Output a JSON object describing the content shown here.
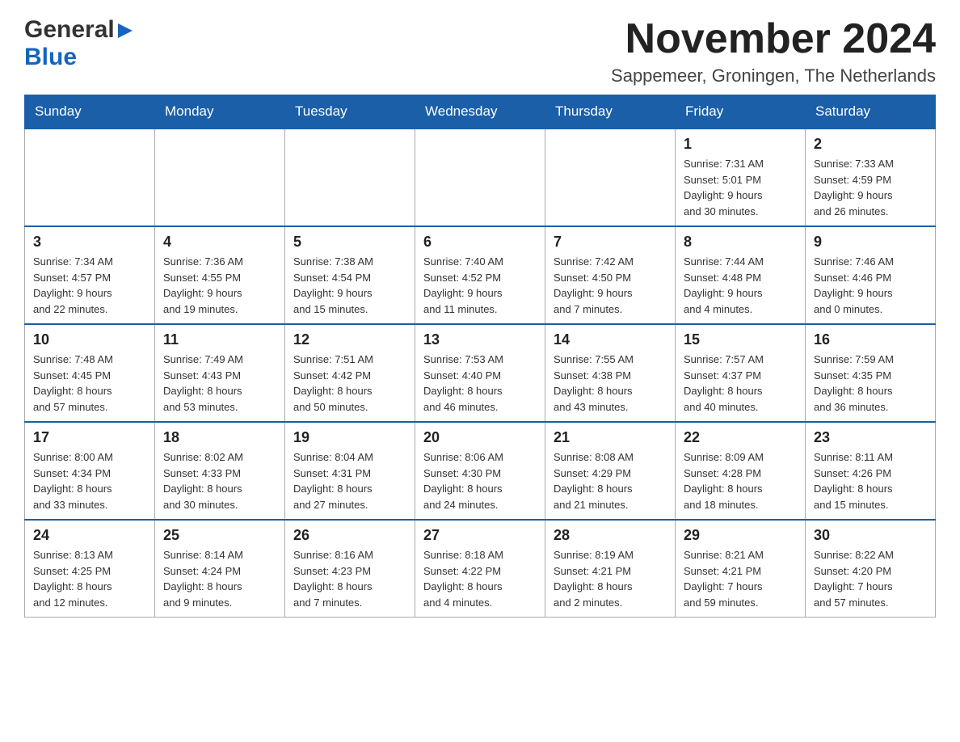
{
  "header": {
    "logo_general": "General",
    "logo_blue": "Blue",
    "month_title": "November 2024",
    "location": "Sappemeer, Groningen, The Netherlands"
  },
  "weekdays": [
    "Sunday",
    "Monday",
    "Tuesday",
    "Wednesday",
    "Thursday",
    "Friday",
    "Saturday"
  ],
  "weeks": [
    [
      {
        "day": "",
        "info": ""
      },
      {
        "day": "",
        "info": ""
      },
      {
        "day": "",
        "info": ""
      },
      {
        "day": "",
        "info": ""
      },
      {
        "day": "",
        "info": ""
      },
      {
        "day": "1",
        "info": "Sunrise: 7:31 AM\nSunset: 5:01 PM\nDaylight: 9 hours\nand 30 minutes."
      },
      {
        "day": "2",
        "info": "Sunrise: 7:33 AM\nSunset: 4:59 PM\nDaylight: 9 hours\nand 26 minutes."
      }
    ],
    [
      {
        "day": "3",
        "info": "Sunrise: 7:34 AM\nSunset: 4:57 PM\nDaylight: 9 hours\nand 22 minutes."
      },
      {
        "day": "4",
        "info": "Sunrise: 7:36 AM\nSunset: 4:55 PM\nDaylight: 9 hours\nand 19 minutes."
      },
      {
        "day": "5",
        "info": "Sunrise: 7:38 AM\nSunset: 4:54 PM\nDaylight: 9 hours\nand 15 minutes."
      },
      {
        "day": "6",
        "info": "Sunrise: 7:40 AM\nSunset: 4:52 PM\nDaylight: 9 hours\nand 11 minutes."
      },
      {
        "day": "7",
        "info": "Sunrise: 7:42 AM\nSunset: 4:50 PM\nDaylight: 9 hours\nand 7 minutes."
      },
      {
        "day": "8",
        "info": "Sunrise: 7:44 AM\nSunset: 4:48 PM\nDaylight: 9 hours\nand 4 minutes."
      },
      {
        "day": "9",
        "info": "Sunrise: 7:46 AM\nSunset: 4:46 PM\nDaylight: 9 hours\nand 0 minutes."
      }
    ],
    [
      {
        "day": "10",
        "info": "Sunrise: 7:48 AM\nSunset: 4:45 PM\nDaylight: 8 hours\nand 57 minutes."
      },
      {
        "day": "11",
        "info": "Sunrise: 7:49 AM\nSunset: 4:43 PM\nDaylight: 8 hours\nand 53 minutes."
      },
      {
        "day": "12",
        "info": "Sunrise: 7:51 AM\nSunset: 4:42 PM\nDaylight: 8 hours\nand 50 minutes."
      },
      {
        "day": "13",
        "info": "Sunrise: 7:53 AM\nSunset: 4:40 PM\nDaylight: 8 hours\nand 46 minutes."
      },
      {
        "day": "14",
        "info": "Sunrise: 7:55 AM\nSunset: 4:38 PM\nDaylight: 8 hours\nand 43 minutes."
      },
      {
        "day": "15",
        "info": "Sunrise: 7:57 AM\nSunset: 4:37 PM\nDaylight: 8 hours\nand 40 minutes."
      },
      {
        "day": "16",
        "info": "Sunrise: 7:59 AM\nSunset: 4:35 PM\nDaylight: 8 hours\nand 36 minutes."
      }
    ],
    [
      {
        "day": "17",
        "info": "Sunrise: 8:00 AM\nSunset: 4:34 PM\nDaylight: 8 hours\nand 33 minutes."
      },
      {
        "day": "18",
        "info": "Sunrise: 8:02 AM\nSunset: 4:33 PM\nDaylight: 8 hours\nand 30 minutes."
      },
      {
        "day": "19",
        "info": "Sunrise: 8:04 AM\nSunset: 4:31 PM\nDaylight: 8 hours\nand 27 minutes."
      },
      {
        "day": "20",
        "info": "Sunrise: 8:06 AM\nSunset: 4:30 PM\nDaylight: 8 hours\nand 24 minutes."
      },
      {
        "day": "21",
        "info": "Sunrise: 8:08 AM\nSunset: 4:29 PM\nDaylight: 8 hours\nand 21 minutes."
      },
      {
        "day": "22",
        "info": "Sunrise: 8:09 AM\nSunset: 4:28 PM\nDaylight: 8 hours\nand 18 minutes."
      },
      {
        "day": "23",
        "info": "Sunrise: 8:11 AM\nSunset: 4:26 PM\nDaylight: 8 hours\nand 15 minutes."
      }
    ],
    [
      {
        "day": "24",
        "info": "Sunrise: 8:13 AM\nSunset: 4:25 PM\nDaylight: 8 hours\nand 12 minutes."
      },
      {
        "day": "25",
        "info": "Sunrise: 8:14 AM\nSunset: 4:24 PM\nDaylight: 8 hours\nand 9 minutes."
      },
      {
        "day": "26",
        "info": "Sunrise: 8:16 AM\nSunset: 4:23 PM\nDaylight: 8 hours\nand 7 minutes."
      },
      {
        "day": "27",
        "info": "Sunrise: 8:18 AM\nSunset: 4:22 PM\nDaylight: 8 hours\nand 4 minutes."
      },
      {
        "day": "28",
        "info": "Sunrise: 8:19 AM\nSunset: 4:21 PM\nDaylight: 8 hours\nand 2 minutes."
      },
      {
        "day": "29",
        "info": "Sunrise: 8:21 AM\nSunset: 4:21 PM\nDaylight: 7 hours\nand 59 minutes."
      },
      {
        "day": "30",
        "info": "Sunrise: 8:22 AM\nSunset: 4:20 PM\nDaylight: 7 hours\nand 57 minutes."
      }
    ]
  ]
}
